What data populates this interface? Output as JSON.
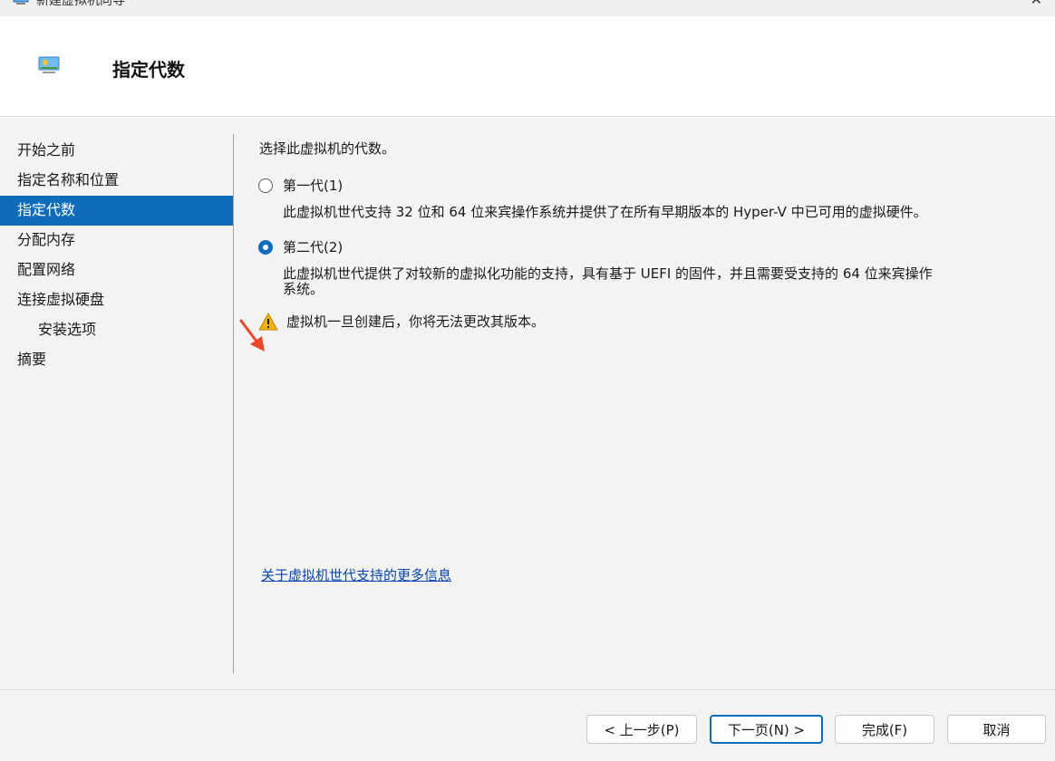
{
  "window": {
    "title": "新建虚拟机向导",
    "close_glyph": "✕"
  },
  "header": {
    "title": "指定代数"
  },
  "nav": {
    "items": [
      {
        "label": "开始之前"
      },
      {
        "label": "指定名称和位置"
      },
      {
        "label": "指定代数",
        "active": true
      },
      {
        "label": "分配内存"
      },
      {
        "label": "配置网络"
      },
      {
        "label": "连接虚拟硬盘"
      },
      {
        "label": "安装选项"
      },
      {
        "label": "摘要"
      }
    ]
  },
  "content": {
    "prompt": "选择此虚拟机的代数。",
    "options": [
      {
        "label": "第一代(1)",
        "checked": false,
        "description": "此虚拟机世代支持 32 位和 64 位来宾操作系统并提供了在所有早期版本的 Hyper-V 中已可用的虚拟硬件。"
      },
      {
        "label": "第二代(2)",
        "checked": true,
        "description_line1": "此虚拟机世代提供了对较新的虚拟化功能的支持，具有基于 UEFI 的固件，并且需要受支持的 64 位来宾操作",
        "description_line2": "系统。"
      }
    ],
    "warning": "虚拟机一旦创建后，你将无法更改其版本。",
    "more_info_link": "关于虚拟机世代支持的更多信息"
  },
  "footer": {
    "back": "< 上一步(P)",
    "next": "下一页(N) >",
    "finish": "完成(F)",
    "cancel": "取消"
  },
  "colors": {
    "accent": "#0f6cbd",
    "annotation_arrow": "#e8492a",
    "warning": "#f2b10e"
  }
}
